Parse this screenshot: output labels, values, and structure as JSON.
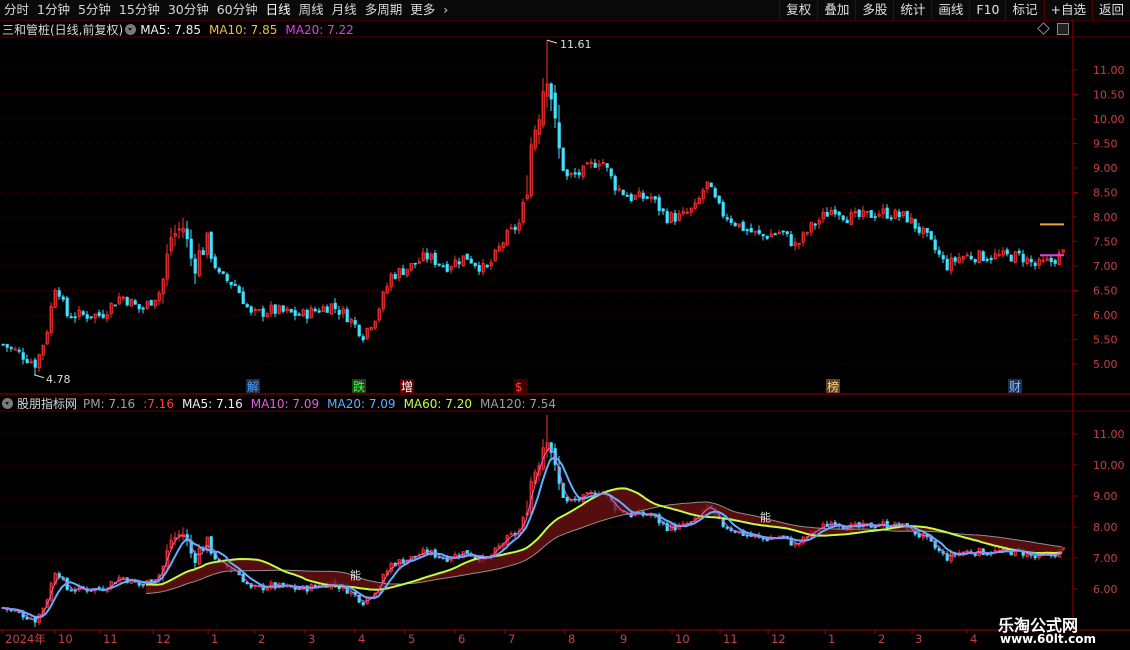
{
  "toolbar": {
    "periods": [
      "分时",
      "1分钟",
      "5分钟",
      "15分钟",
      "30分钟",
      "60分钟",
      "日线",
      "周线",
      "月线",
      "多周期",
      "更多"
    ],
    "active_period": "日线",
    "more_arrow": "›",
    "right_buttons": [
      "复权",
      "叠加",
      "多股",
      "统计",
      "画线",
      "F10",
      "标记",
      "+自选",
      "返回"
    ]
  },
  "main_panel": {
    "title": "三和管桩(日线,前复权)",
    "indicators": [
      {
        "label": "MA5: 7.85",
        "color": "#f0f0f0"
      },
      {
        "label": "MA10: 7.85",
        "color": "#e8c040"
      },
      {
        "label": "MA20: 7.22",
        "color": "#e040e0"
      }
    ],
    "y_ticks": [
      "11.00",
      "10.50",
      "10.00",
      "9.50",
      "9.00",
      "8.50",
      "8.00",
      "7.50",
      "7.00",
      "6.50",
      "6.00",
      "5.50",
      "5.00"
    ],
    "high_label": "11.61",
    "low_label": "4.78",
    "events": [
      {
        "text": "解",
        "color": "#40a0ff",
        "bg": "#203048"
      },
      {
        "text": "跌",
        "color": "#40ff40",
        "bg": "#204020"
      },
      {
        "text": "增",
        "color": "#ffffff",
        "bg": "#600000"
      },
      {
        "text": "$",
        "color": "#ff4040",
        "bg": "#400000"
      },
      {
        "text": "榜",
        "color": "#ffd080",
        "bg": "#604020"
      },
      {
        "text": "财",
        "color": "#80c0ff",
        "bg": "#203050"
      }
    ]
  },
  "sub_panel": {
    "title": "股朋指标网",
    "indicators": [
      {
        "label": "PM: 7.16",
        "color": "#a0a0a0"
      },
      {
        "label": ":7.16",
        "color": "#ff4040"
      },
      {
        "label": "MA5: 7.16",
        "color": "#f0f0f0"
      },
      {
        "label": "MA10: 7.09",
        "color": "#e060e0"
      },
      {
        "label": "MA20: 7.09",
        "color": "#60b0ff"
      },
      {
        "label": "MA60: 7.20",
        "color": "#c0ff40"
      },
      {
        "label": "MA120: 7.54",
        "color": "#a0a0a0"
      }
    ],
    "y_ticks": [
      "11.00",
      "10.00",
      "9.00",
      "8.00",
      "7.00",
      "6.00"
    ],
    "labels": [
      "能",
      "能"
    ]
  },
  "time_axis": [
    "2024年",
    "10",
    "11",
    "12",
    "1",
    "2",
    "3",
    "4",
    "5",
    "6",
    "7",
    "8",
    "9",
    "10",
    "11",
    "12",
    "1",
    "2",
    "3",
    "4"
  ],
  "watermark": {
    "line1": "乐淘公式网",
    "line2": "www.60lt.com"
  },
  "colors": {
    "up": "#ff3030",
    "down": "#40e0ff",
    "grid": "#5a0000"
  }
}
